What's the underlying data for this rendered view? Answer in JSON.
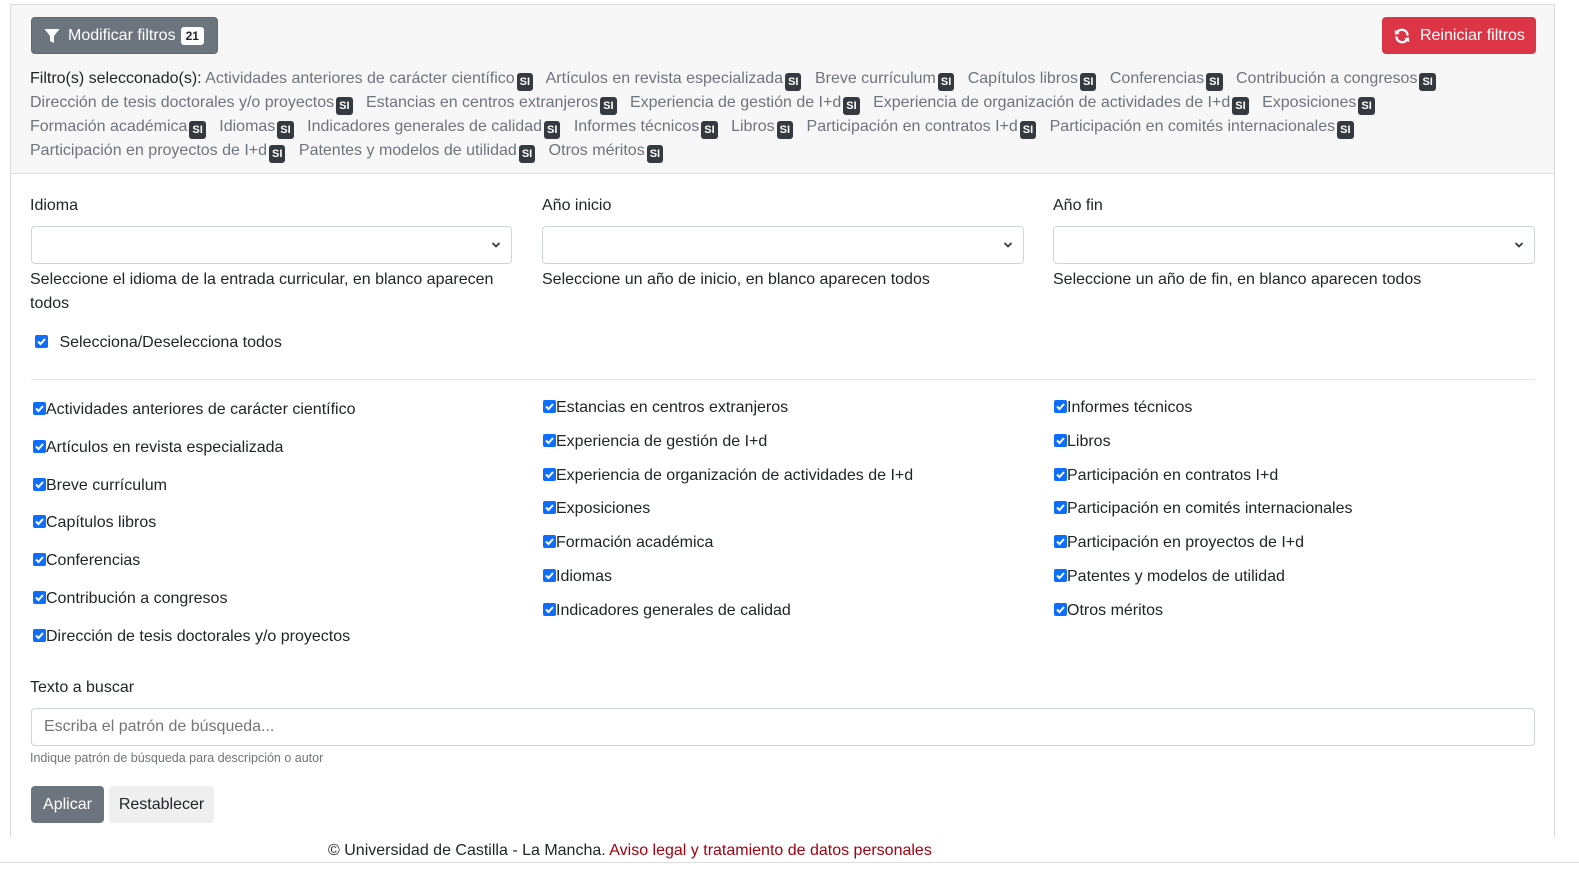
{
  "header": {
    "modify_label": "Modificar filtros",
    "modify_count": "21",
    "reset_label": "Reiniciar filtros",
    "selected_lead": "Filtro(s) selecconado(s):",
    "badge_text": "SI",
    "selected_filters": [
      "Actividades anteriores de carácter científico",
      "Artículos en revista especializada",
      "Breve currículum",
      "Capítulos libros",
      "Conferencias",
      "Contribución a congresos",
      "Dirección de tesis doctorales y/o proyectos",
      "Estancias en centros extranjeros",
      "Experiencia de gestión de I+d",
      "Experiencia de organización de actividades de I+d",
      "Exposiciones",
      "Formación académica",
      "Idiomas",
      "Indicadores generales de calidad",
      "Informes técnicos",
      "Libros",
      "Participación en contratos I+d",
      "Participación en comités internacionales",
      "Participación en proyectos de I+d",
      "Patentes y modelos de utilidad",
      "Otros méritos"
    ]
  },
  "fields": {
    "idioma_label": "Idioma",
    "idioma_help": "Seleccione el idioma de la entrada curricular, en blanco aparecen todos",
    "inicio_label": "Año inicio",
    "inicio_help": "Seleccione un año de inicio, en blanco aparecen todos",
    "fin_label": "Año fin",
    "fin_help": "Seleccione un año de fin, en blanco aparecen todos",
    "select_all_label": "Selecciona/Deselecciona todos"
  },
  "checkboxes": {
    "col1": [
      "Actividades anteriores de carácter científico",
      "Artículos en revista especializada",
      "Breve currículum",
      "Capítulos libros",
      "Conferencias",
      "Contribución a congresos",
      "Dirección de tesis doctorales y/o proyectos"
    ],
    "col2": [
      "Estancias en centros extranjeros",
      "Experiencia de gestión de I+d",
      "Experiencia de organización de actividades de I+d",
      "Exposiciones",
      "Formación académica",
      "Idiomas",
      "Indicadores generales de calidad"
    ],
    "col3": [
      "Informes técnicos",
      "Libros",
      "Participación en contratos I+d",
      "Participación en comités internacionales",
      "Participación en proyectos de I+d",
      "Patentes y modelos de utilidad",
      "Otros méritos"
    ]
  },
  "search": {
    "label": "Texto a buscar",
    "placeholder": "Escriba el patrón de búsqueda...",
    "help": "Indique patrón de búsqueda para descripción o autor",
    "apply_label": "Aplicar",
    "restore_label": "Restablecer"
  },
  "footer": {
    "copyright": "© Universidad de Castilla - La Mancha.",
    "legal_link": "Aviso legal y tratamiento de datos personales"
  },
  "colors": {
    "primary": "#0d6efd",
    "secondary": "#6c757d",
    "danger": "#dc3545",
    "footer_link": "#a4000f"
  },
  "icons": {
    "modify": "filter-icon",
    "reset": "refresh-icon",
    "select": "chevron-down-icon",
    "checkbox": "checkmark-icon"
  }
}
